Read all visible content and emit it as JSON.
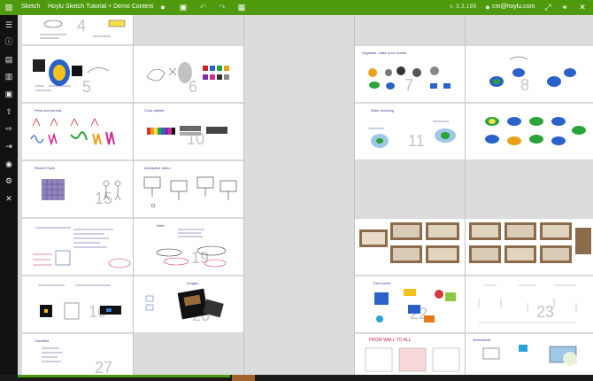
{
  "topbar": {
    "app_name": "Sketch",
    "doc_title": "Hoylu Sketch Tutorial + Demo Content",
    "version": "v. 3.3.186",
    "user_email": "cm@hoylu.com",
    "accent": "#4e9a0c"
  },
  "toolbar_icons": [
    "lock-icon",
    "save-icon",
    "undo-icon",
    "redo-icon",
    "export-icon"
  ],
  "sidebar_icons": [
    "menu-icon",
    "info-icon",
    "folder-icon",
    "open-folder-icon",
    "save-icon",
    "upload-icon",
    "login-icon",
    "share-icon",
    "camera-icon",
    "settings-icon",
    "close-icon"
  ],
  "tiles": {
    "t4": "4",
    "t5": "5",
    "t6": "6",
    "t7": "7",
    "t8": "8",
    "t10": "10",
    "t11": "11",
    "t15": "15",
    "t16": "16",
    "t19": "19",
    "t20": "20",
    "t22": "22",
    "t23": "23",
    "t27": "27"
  },
  "captions": {
    "c_pens": "Pens and pencils",
    "c_color": "Color palette",
    "c_recent": "Recent Tools",
    "c_interactive": "Interactive demo",
    "c_note": "Note",
    "c_images": "Images",
    "c_organize": "Organize, make your doodle",
    "c_brainstorm": "Brain storming",
    "c_trainer": "Train tracks",
    "c_screen": "Screenshot",
    "c_checklist": "Checklist",
    "c_from_wall": "FROM WALL TO ALL"
  }
}
